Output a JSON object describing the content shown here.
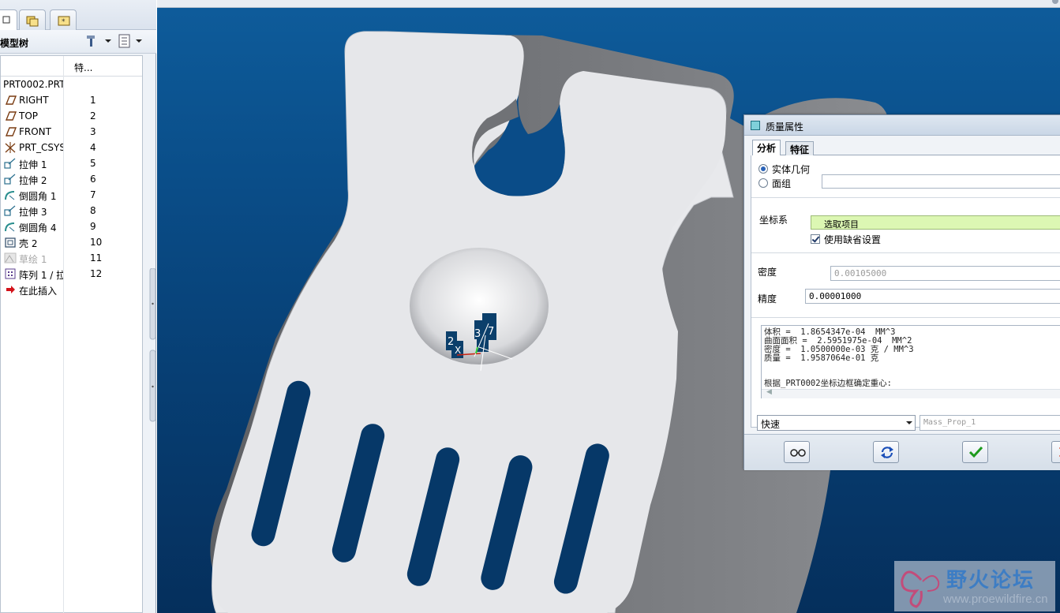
{
  "left_panel": {
    "tree_title": "模型树",
    "col_features_header": "特...",
    "tree_items": [
      {
        "name": "PRT0002.PRT",
        "num": "",
        "icon": "part-icon"
      },
      {
        "name": "RIGHT",
        "num": "1",
        "icon": "datum-plane-icon"
      },
      {
        "name": "TOP",
        "num": "2",
        "icon": "datum-plane-icon"
      },
      {
        "name": "FRONT",
        "num": "3",
        "icon": "datum-plane-icon"
      },
      {
        "name": "PRT_CSYS",
        "num": "4",
        "icon": "csys-icon"
      },
      {
        "name": "拉伸 1",
        "num": "5",
        "icon": "extrude-icon"
      },
      {
        "name": "拉伸 2",
        "num": "6",
        "icon": "extrude-icon"
      },
      {
        "name": "倒圆角 1",
        "num": "7",
        "icon": "round-icon"
      },
      {
        "name": "拉伸 3",
        "num": "8",
        "icon": "extrude-icon"
      },
      {
        "name": "倒圆角 4",
        "num": "9",
        "icon": "round-icon"
      },
      {
        "name": "壳 2",
        "num": "10",
        "icon": "shell-icon"
      },
      {
        "name": "草绘 1",
        "num": "11",
        "icon": "sketch-icon"
      },
      {
        "name": "阵列 1 / 拉",
        "num": "12",
        "icon": "pattern-icon"
      },
      {
        "name": "在此插入",
        "num": "",
        "icon": "insert-arrow-icon"
      }
    ]
  },
  "viewport": {
    "csys_labels": [
      "2",
      "X",
      "3",
      "7"
    ]
  },
  "dialog": {
    "title": "质量属性",
    "tabs": [
      "分析",
      "特征"
    ],
    "radio_solid": "实体几何",
    "radio_quilt": "面组",
    "csys_label": "坐标系",
    "csys_value": "选取项目",
    "use_default": "使用缺省设置",
    "density_label": "密度",
    "density_value": "0.00105000",
    "accuracy_label": "精度",
    "accuracy_value": "0.00001000",
    "results_lines": [
      "体积 =  1.8654347e-04  MM^3",
      "曲面面积 =  2.5951975e-04  MM^2",
      "密度 =  1.0500000e-03 克 / MM^3",
      "质量 =  1.9587064e-01 克"
    ],
    "results_note": "根据_PRT0002坐标边框确定重心:",
    "mode_value": "快速",
    "name_value": "Mass_Prop_1"
  },
  "watermark": {
    "title": "野火论坛",
    "url": "www.proewildfire.cn"
  },
  "colors": {
    "viewport_top": "#0e5c9b",
    "viewport_bottom": "#052f5c",
    "model_face": "#e8e9ec",
    "selection_green": "#dcf7b3"
  }
}
